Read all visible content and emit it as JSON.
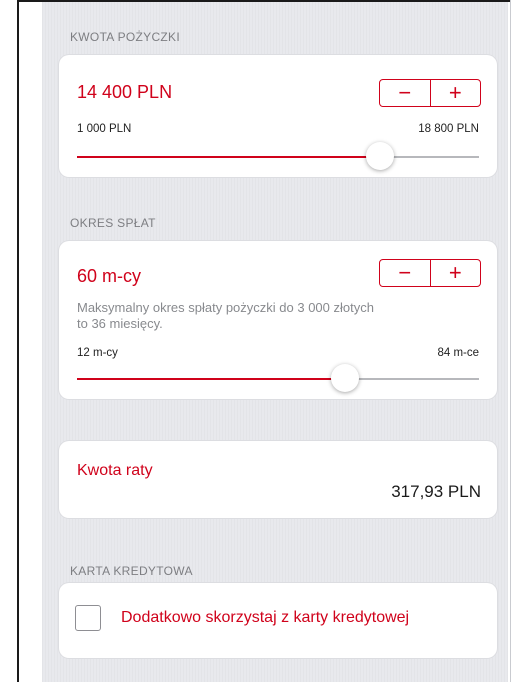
{
  "loan_amount": {
    "section_label": "KWOTA POŻYCZKI",
    "value": "14 400 PLN",
    "min_label": "1 000 PLN",
    "max_label": "18 800 PLN",
    "min": 1000,
    "max": 18800,
    "current": 14400,
    "minus_label": "−",
    "plus_label": "+"
  },
  "repayment_period": {
    "section_label": "OKRES SPŁAT",
    "value": "60 m-cy",
    "note": "Maksymalny okres spłaty pożyczki do 3 000 złotych to 36 miesięcy.",
    "min_label": "12 m-cy",
    "max_label": "84 m-ce",
    "min": 12,
    "max": 84,
    "current": 60,
    "minus_label": "−",
    "plus_label": "+"
  },
  "installment": {
    "label": "Kwota raty",
    "value": "317,93 PLN"
  },
  "credit_card": {
    "section_label": "KARTA KREDYTOWA",
    "checkbox_label": "Dodatkowo skorzystaj z karty kredytowej",
    "checked": false
  },
  "colors": {
    "accent": "#d0021b",
    "background": "#e8e9ed"
  }
}
